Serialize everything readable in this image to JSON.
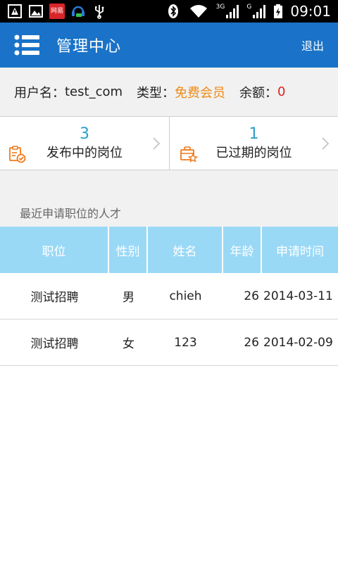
{
  "status_bar": {
    "net_badge": "网易",
    "net_badge_sub": "",
    "signal_3g": "3G",
    "signal_g": "G",
    "time": "09:01"
  },
  "app_bar": {
    "title": "管理中心",
    "logout_label": "退出"
  },
  "account": {
    "username_label": "用户名：",
    "username_value": "test_com",
    "type_label": "类型：",
    "type_value": "免费会员",
    "balance_label": "余额：",
    "balance_value": "0"
  },
  "stats": [
    {
      "count": "3",
      "label": "发布中的岗位",
      "icon": "clipboard-check-icon"
    },
    {
      "count": "1",
      "label": "已过期的岗位",
      "icon": "briefcase-star-icon"
    }
  ],
  "section": {
    "title": "最近申请职位的人才"
  },
  "table": {
    "headers": [
      "职位",
      "性别",
      "姓名",
      "年龄",
      "申请时间"
    ],
    "rows": [
      [
        "测试招聘",
        "男",
        "chieh",
        "26",
        "2014-03-11"
      ],
      [
        "测试招聘",
        "女",
        "123",
        "26",
        "2014-02-09"
      ]
    ]
  },
  "colors": {
    "app_bar": "#1a73c8",
    "accent_count": "#2aa0c8",
    "type_value": "#f08a14",
    "balance_value": "#e02020",
    "table_header": "#9ad9f6",
    "icon_orange": "#f07a1a"
  }
}
